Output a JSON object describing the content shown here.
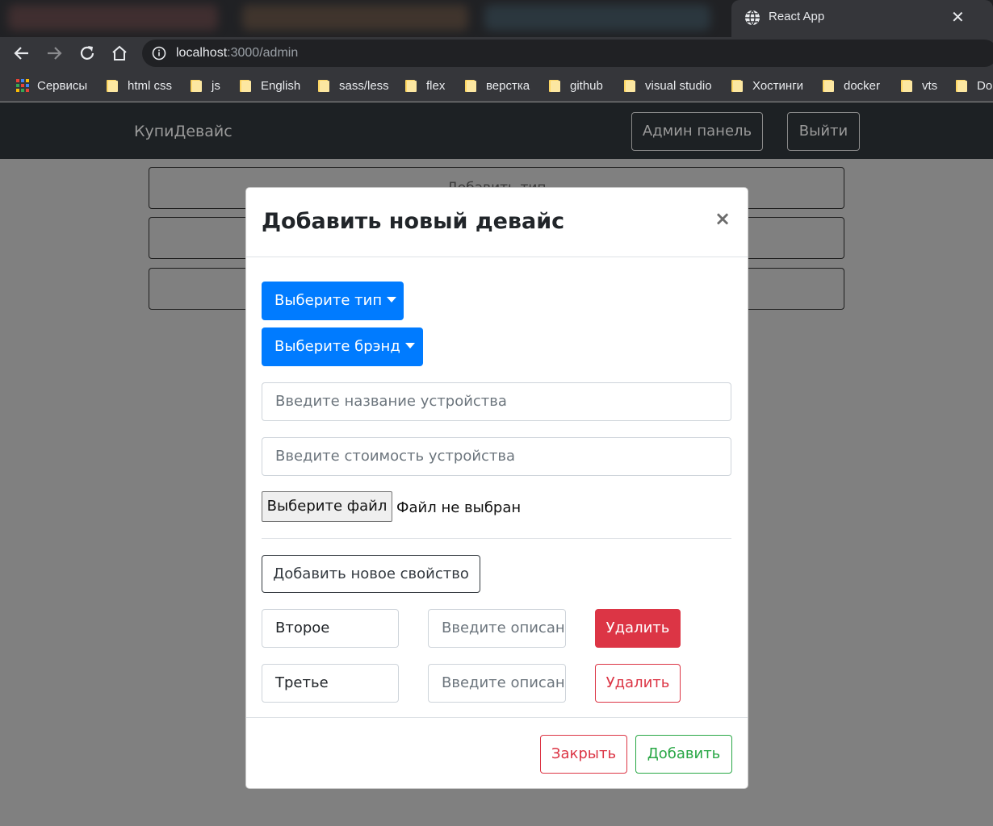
{
  "browser": {
    "tab": {
      "title": "React App",
      "close": "✕"
    },
    "url": {
      "host": "localhost",
      "path": ":3000/admin"
    },
    "bookmarks": [
      "Сервисы",
      "html css",
      "js",
      "English",
      "sass/less",
      "flex",
      "верстка",
      "github",
      "visual studio",
      "Хостинги",
      "docker",
      "vts",
      "Do"
    ]
  },
  "navbar": {
    "brand": "КупиДевайс",
    "admin_label": "Админ панель",
    "logout_label": "Выйти"
  },
  "page": {
    "buttons": [
      "Добавить тип",
      "",
      ""
    ]
  },
  "modal": {
    "title": "Добавить новый девайс",
    "close": "×",
    "type_dropdown": "Выберите тип",
    "brand_dropdown": "Выберите брэнд",
    "name_placeholder": "Введите название устройства",
    "price_placeholder": "Введите стоимость устройства",
    "file_button": "Выберите файл",
    "file_status": "Файл не выбран",
    "add_property": "Добавить новое свойство",
    "properties": [
      {
        "title": "Второе",
        "description_placeholder": "Введите описание",
        "delete": "Удалить"
      },
      {
        "title": "Третье",
        "description_placeholder": "Введите описание",
        "delete": "Удалить"
      }
    ],
    "footer": {
      "close": "Закрыть",
      "add": "Добавить"
    }
  },
  "colors": {
    "primary": "#007bff",
    "danger": "#dc3545",
    "success": "#28a745",
    "navbar": "#1d2124",
    "backdrop": "#808080"
  }
}
